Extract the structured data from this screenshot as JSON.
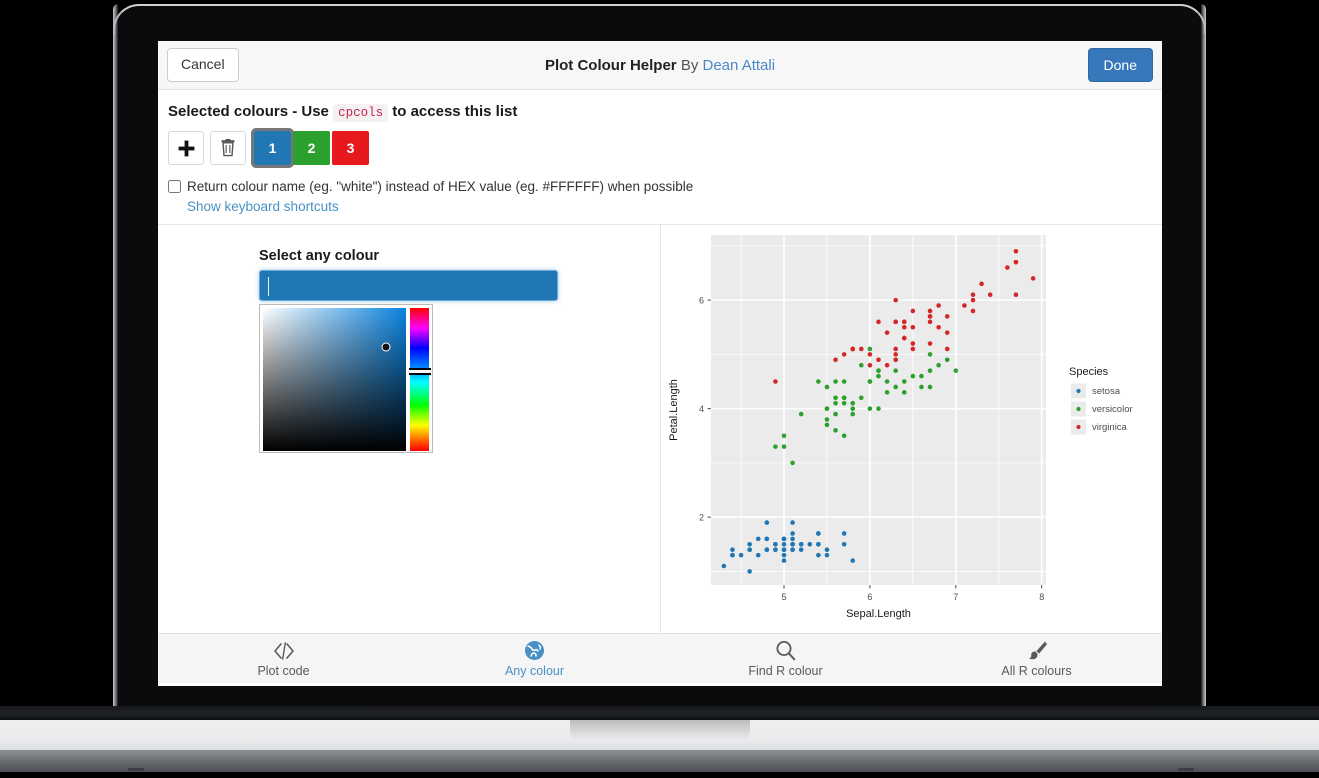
{
  "header": {
    "cancel_label": "Cancel",
    "title": "Plot Colour Helper",
    "by": "By",
    "author": "Dean Attali",
    "done_label": "Done"
  },
  "selected_colours": {
    "heading_before": "Selected colours - Use",
    "code_chip": "cpcols",
    "heading_after": "to access this list",
    "add_button_label": "+",
    "delete_button_label": "trash",
    "swatches": [
      {
        "index": "1",
        "colour": "#2077b4",
        "selected": true
      },
      {
        "index": "2",
        "colour": "#2ca02c",
        "selected": false
      },
      {
        "index": "3",
        "colour": "#e8191c",
        "selected": false
      }
    ],
    "return_name_checkbox_label": "Return colour name (eg. \"white\") instead of HEX value (eg. #FFFFFF) when possible",
    "return_name_checked": false,
    "shortcuts_link": "Show keyboard shortcuts"
  },
  "picker": {
    "title": "Select any colour",
    "input_value": "",
    "input_colour": "#2077b4",
    "hue_marker_pct": 44,
    "sv_dot_x_pct": 84,
    "sv_dot_y_pct": 27
  },
  "bottom_nav": {
    "items": [
      {
        "label": "Plot code",
        "icon": "code-icon",
        "active": false
      },
      {
        "label": "Any colour",
        "icon": "globe-icon",
        "active": true
      },
      {
        "label": "Find R colour",
        "icon": "search-icon",
        "active": false
      },
      {
        "label": "All R colours",
        "icon": "paintbrush-icon",
        "active": false
      }
    ]
  },
  "chart_data": {
    "type": "scatter",
    "title": "",
    "xlabel": "Sepal.Length",
    "ylabel": "Petal.Length",
    "xlim": [
      4.15,
      8.05
    ],
    "ylim": [
      0.75,
      7.2
    ],
    "xticks": [
      5,
      6,
      7,
      8
    ],
    "yticks": [
      2,
      4,
      6
    ],
    "grid": true,
    "panel_background": "#ebebeb",
    "grid_major_colour": "#ffffff",
    "legend": {
      "title": "Species",
      "position": "right",
      "entries": [
        {
          "name": "setosa",
          "colour": "#2077b4"
        },
        {
          "name": "versicolor",
          "colour": "#2ca02c"
        },
        {
          "name": "virginica",
          "colour": "#d62728"
        }
      ]
    },
    "series": [
      {
        "name": "setosa",
        "colour": "#2077b4",
        "points": [
          [
            5.1,
            1.4
          ],
          [
            4.9,
            1.4
          ],
          [
            4.7,
            1.3
          ],
          [
            4.6,
            1.5
          ],
          [
            5.0,
            1.4
          ],
          [
            5.4,
            1.7
          ],
          [
            4.6,
            1.4
          ],
          [
            5.0,
            1.5
          ],
          [
            4.4,
            1.4
          ],
          [
            4.9,
            1.5
          ],
          [
            5.4,
            1.5
          ],
          [
            4.8,
            1.6
          ],
          [
            4.8,
            1.4
          ],
          [
            4.3,
            1.1
          ],
          [
            5.8,
            1.2
          ],
          [
            5.7,
            1.5
          ],
          [
            5.4,
            1.3
          ],
          [
            5.1,
            1.4
          ],
          [
            5.7,
            1.7
          ],
          [
            5.1,
            1.5
          ],
          [
            5.4,
            1.7
          ],
          [
            5.1,
            1.5
          ],
          [
            4.6,
            1.0
          ],
          [
            5.1,
            1.7
          ],
          [
            4.8,
            1.9
          ],
          [
            5.0,
            1.6
          ],
          [
            5.0,
            1.6
          ],
          [
            5.2,
            1.5
          ],
          [
            5.2,
            1.4
          ],
          [
            4.7,
            1.6
          ],
          [
            4.8,
            1.6
          ],
          [
            5.4,
            1.5
          ],
          [
            5.2,
            1.5
          ],
          [
            5.5,
            1.4
          ],
          [
            4.9,
            1.5
          ],
          [
            5.0,
            1.2
          ],
          [
            5.5,
            1.3
          ],
          [
            4.9,
            1.4
          ],
          [
            4.4,
            1.3
          ],
          [
            5.1,
            1.5
          ],
          [
            5.0,
            1.3
          ],
          [
            4.5,
            1.3
          ],
          [
            4.4,
            1.3
          ],
          [
            5.0,
            1.6
          ],
          [
            5.1,
            1.9
          ],
          [
            4.8,
            1.4
          ],
          [
            5.1,
            1.6
          ],
          [
            4.6,
            1.4
          ],
          [
            5.3,
            1.5
          ],
          [
            5.0,
            1.4
          ]
        ]
      },
      {
        "name": "versicolor",
        "colour": "#2ca02c",
        "points": [
          [
            7.0,
            4.7
          ],
          [
            6.4,
            4.5
          ],
          [
            6.9,
            4.9
          ],
          [
            5.5,
            4.0
          ],
          [
            6.5,
            4.6
          ],
          [
            5.7,
            4.5
          ],
          [
            6.3,
            4.7
          ],
          [
            4.9,
            3.3
          ],
          [
            6.6,
            4.6
          ],
          [
            5.2,
            3.9
          ],
          [
            5.0,
            3.5
          ],
          [
            5.9,
            4.2
          ],
          [
            6.0,
            4.0
          ],
          [
            6.1,
            4.7
          ],
          [
            5.6,
            3.6
          ],
          [
            6.7,
            4.4
          ],
          [
            5.6,
            4.5
          ],
          [
            5.8,
            4.1
          ],
          [
            6.2,
            4.5
          ],
          [
            5.6,
            3.9
          ],
          [
            5.9,
            4.8
          ],
          [
            6.1,
            4.0
          ],
          [
            6.3,
            4.9
          ],
          [
            6.1,
            4.7
          ],
          [
            6.4,
            4.3
          ],
          [
            6.6,
            4.4
          ],
          [
            6.8,
            4.8
          ],
          [
            6.7,
            5.0
          ],
          [
            6.0,
            4.5
          ],
          [
            5.7,
            3.5
          ],
          [
            5.5,
            3.8
          ],
          [
            5.5,
            3.7
          ],
          [
            5.8,
            3.9
          ],
          [
            6.0,
            5.1
          ],
          [
            5.4,
            4.5
          ],
          [
            6.0,
            4.5
          ],
          [
            6.7,
            4.7
          ],
          [
            6.3,
            4.4
          ],
          [
            5.6,
            4.1
          ],
          [
            5.5,
            4.0
          ],
          [
            5.5,
            4.4
          ],
          [
            6.1,
            4.6
          ],
          [
            5.8,
            4.0
          ],
          [
            5.0,
            3.3
          ],
          [
            5.6,
            4.2
          ],
          [
            5.7,
            4.2
          ],
          [
            5.7,
            4.2
          ],
          [
            6.2,
            4.3
          ],
          [
            5.1,
            3.0
          ],
          [
            5.7,
            4.1
          ]
        ]
      },
      {
        "name": "virginica",
        "colour": "#d62728",
        "points": [
          [
            6.3,
            6.0
          ],
          [
            5.8,
            5.1
          ],
          [
            7.1,
            5.9
          ],
          [
            6.3,
            5.6
          ],
          [
            6.5,
            5.8
          ],
          [
            7.6,
            6.6
          ],
          [
            4.9,
            4.5
          ],
          [
            7.3,
            6.3
          ],
          [
            6.7,
            5.8
          ],
          [
            7.2,
            6.1
          ],
          [
            6.5,
            5.1
          ],
          [
            6.4,
            5.3
          ],
          [
            6.8,
            5.5
          ],
          [
            5.7,
            5.0
          ],
          [
            5.8,
            5.1
          ],
          [
            6.4,
            5.3
          ],
          [
            6.5,
            5.5
          ],
          [
            7.7,
            6.7
          ],
          [
            7.7,
            6.9
          ],
          [
            6.0,
            5.0
          ],
          [
            6.9,
            5.7
          ],
          [
            5.6,
            4.9
          ],
          [
            7.7,
            6.7
          ],
          [
            6.3,
            4.9
          ],
          [
            6.7,
            5.7
          ],
          [
            7.2,
            6.0
          ],
          [
            6.2,
            4.8
          ],
          [
            6.1,
            4.9
          ],
          [
            6.4,
            5.6
          ],
          [
            7.2,
            5.8
          ],
          [
            7.4,
            6.1
          ],
          [
            7.9,
            6.4
          ],
          [
            6.4,
            5.6
          ],
          [
            6.3,
            5.1
          ],
          [
            6.1,
            5.6
          ],
          [
            7.7,
            6.1
          ],
          [
            6.3,
            5.6
          ],
          [
            6.4,
            5.5
          ],
          [
            6.0,
            4.8
          ],
          [
            6.9,
            5.4
          ],
          [
            6.7,
            5.6
          ],
          [
            6.9,
            5.1
          ],
          [
            5.8,
            5.1
          ],
          [
            6.8,
            5.9
          ],
          [
            6.7,
            5.7
          ],
          [
            6.7,
            5.2
          ],
          [
            6.3,
            5.0
          ],
          [
            6.5,
            5.2
          ],
          [
            6.2,
            5.4
          ],
          [
            5.9,
            5.1
          ]
        ]
      }
    ]
  }
}
